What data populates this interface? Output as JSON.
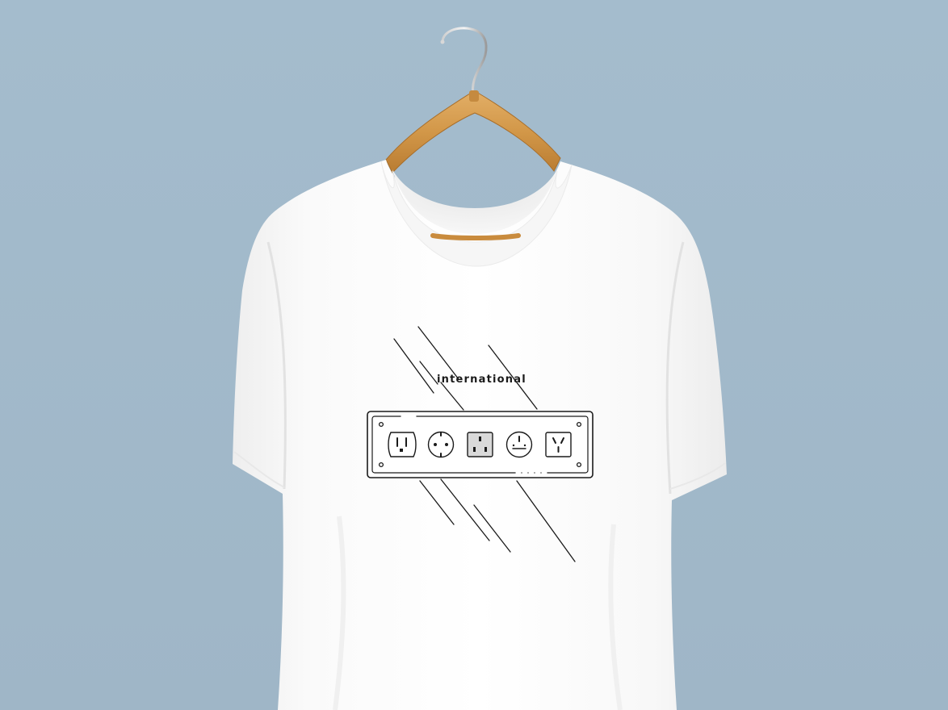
{
  "scene": {
    "description_visible": false,
    "background_color": "#a2b9ca",
    "shirt_color": "#ffffff",
    "hanger_color": "#d49a4e",
    "print_color": "#1a1a1a"
  },
  "print": {
    "word": "international",
    "sockets": [
      {
        "type": "type-b-outlet-icon"
      },
      {
        "type": "type-f-schuko-icon"
      },
      {
        "type": "type-g-uk-icon"
      },
      {
        "type": "type-e-french-icon"
      },
      {
        "type": "type-i-australian-icon"
      }
    ]
  }
}
